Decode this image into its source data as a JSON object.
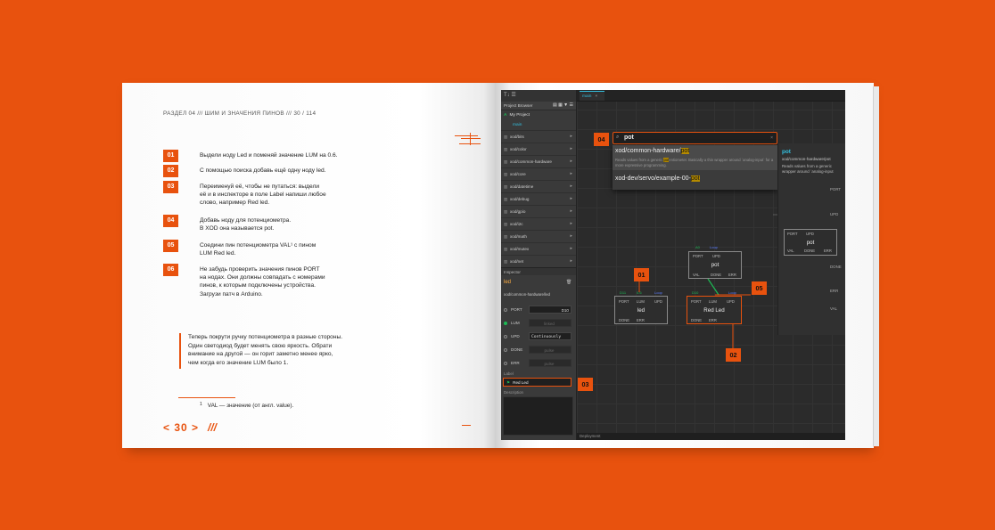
{
  "book": {
    "running_head": "РАЗДЕЛ 04 /// ШИМ И ЗНАЧЕНИЯ ПИНОВ /// 30 / 114",
    "steps": [
      {
        "num": "01",
        "text": "Выдели ноду Led и поменяй значение LUM на 0.6."
      },
      {
        "num": "02",
        "text": "С помощью поиска добавь ещё одну ноду led."
      },
      {
        "num": "03",
        "text": "Переименуй её, чтобы не путаться: выдели\nеё и в инспекторе в поле Label напиши любое\nслово, например Red led."
      },
      {
        "num": "04",
        "text": "Добавь ноду для потенциометра.\nВ XOD она называется pot."
      },
      {
        "num": "05",
        "text": "Соедини пин потенциометра VAL¹ с пином\nLUM Red led."
      },
      {
        "num": "06",
        "text": "Не забудь проверить значения пинов PORT\nна нодах. Они должны совпадать с номерами\nпинов, к которым подключены устройства.\nЗагрузи патч в Arduino."
      }
    ],
    "quote": "Теперь покрути ручку потенциометра в разные стороны.\nОдин светодиод будет менять свою яркость. Обрати\nвнимание на другой — он горит заметно менее ярко,\nчем когда его значение LUM было 1.",
    "footnote_num": "1",
    "footnote": "VAL — значение (от англ. value).",
    "page_nav": "< 30 >",
    "slashes": "///"
  },
  "ide": {
    "project_browser_title": "Project Browser",
    "project_name": "My Project",
    "main_patch": "main",
    "libraries": [
      "xod/bits",
      "xod/color",
      "xod/common-hardware",
      "xod/core",
      "xod/datetime",
      "xod/debug",
      "xod/gpio",
      "xod/i2c",
      "xod/math",
      "xod/mutex",
      "xod/net"
    ],
    "tab": "main",
    "inspector_title": "Inspector",
    "inspector_node": "led",
    "inspector_path": "xod/common-hardware/led",
    "pins": [
      {
        "name": "PORT",
        "value": "D10"
      },
      {
        "name": "LUM",
        "value": "linked"
      },
      {
        "name": "UPD",
        "value": "Continuously"
      },
      {
        "name": "DONE",
        "value": "pulse"
      },
      {
        "name": "ERR",
        "value": "pulse"
      }
    ],
    "label_caption": "Label",
    "label_value": "Red Led",
    "description_caption": "Description",
    "deployment": "Deployment",
    "search_query": "pot",
    "suggestion1_prefix": "xod/common-hardware/",
    "suggestion1_match": "pot",
    "suggestion1_desc_a": "Reads values from a generic ",
    "suggestion1_desc_match": "pot",
    "suggestion1_desc_b": "entiometer. Basically a thin wrapper around `analog-input` for a more expressive programming.",
    "suggestion2_prefix": "xod-dev/servo/example-00-",
    "suggestion2_match": "pot",
    "info_title": "pot",
    "info_path": "xod/common-hardware/pot",
    "info_desc": "Reads values from a generic wrapper around `analog-input",
    "info_pins": [
      "PORT",
      "UPD",
      "DONE",
      "ERR",
      "VAL"
    ],
    "nodes": {
      "led": {
        "name": "led",
        "top_vals": [
          "D11",
          "0.6",
          "Loop"
        ],
        "top": [
          "PORT",
          "LUM",
          "UPD"
        ],
        "bottom": [
          "DONE",
          "ERR"
        ]
      },
      "pot": {
        "name": "pot",
        "top_vals": [
          "A0",
          "Loop"
        ],
        "top": [
          "PORT",
          "UPD"
        ],
        "bottom": [
          "VAL",
          "DONE",
          "ERR"
        ]
      },
      "red_led": {
        "name": "Red Led",
        "top_vals": [
          "D10",
          "Loop"
        ],
        "top": [
          "PORT",
          "LUM",
          "UPD"
        ],
        "bottom": [
          "DONE",
          "ERR"
        ]
      },
      "info_pot": {
        "name": "pot",
        "top": [
          "PORT",
          "UPD"
        ],
        "bottom": [
          "VAL",
          "DONE",
          "ERR"
        ]
      }
    },
    "callouts": [
      "01",
      "02",
      "03",
      "04",
      "05"
    ]
  },
  "colors": {
    "accent": "#e8520e",
    "link": "#33c0e0",
    "pin_green": "#1db954",
    "pin_blue": "#5a7cff"
  }
}
